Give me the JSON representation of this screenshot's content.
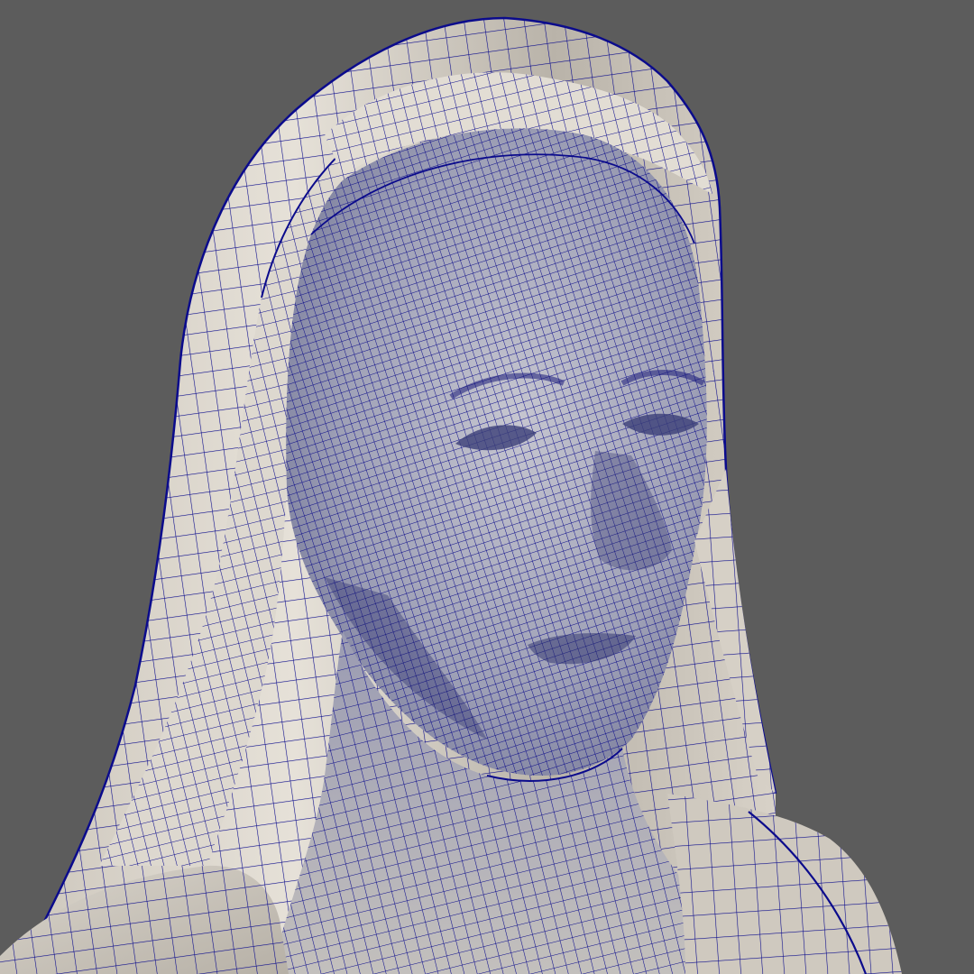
{
  "viewport": {
    "background_color": "#5c5c5c",
    "render_mode": "wireframe-on-shaded",
    "subject": "veiled-female-bust-sculpture"
  },
  "colors": {
    "wire": "#0b0b8c",
    "wire_dense": "#10108a",
    "marble_light": "#e4dfd6",
    "marble_mid": "#bdb7ad",
    "marble_shadow": "#8a857d",
    "face_tint": "#aeb0c4"
  },
  "icons": []
}
